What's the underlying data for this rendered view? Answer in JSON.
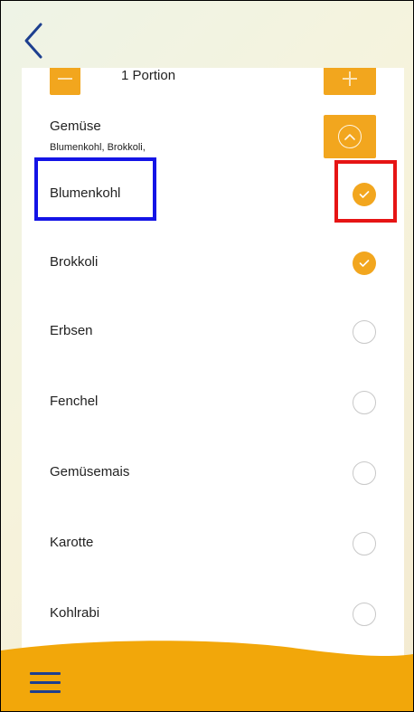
{
  "nav": {
    "back_icon": "chevron-left-icon"
  },
  "portion": {
    "label": "1 Portion",
    "minus_icon": "minus-icon",
    "plus_icon": "plus-icon"
  },
  "category": {
    "title": "Gemüse",
    "selected_summary": "Blumenkohl, Brokkoli,",
    "collapse_icon": "chevron-up-circle-icon"
  },
  "items": [
    {
      "label": "Blumenkohl",
      "checked": true
    },
    {
      "label": "Brokkoli",
      "checked": true
    },
    {
      "label": "Erbsen",
      "checked": false
    },
    {
      "label": "Fenchel",
      "checked": false
    },
    {
      "label": "Gemüsemais",
      "checked": false
    },
    {
      "label": "Karotte",
      "checked": false
    },
    {
      "label": "Kohlrabi",
      "checked": false
    }
  ],
  "footer": {
    "menu_icon": "hamburger-menu-icon"
  },
  "colors": {
    "accent": "#f2a61e",
    "nav_icon": "#1d3f8f",
    "highlight_label": "#1414e6",
    "highlight_check": "#e61414"
  }
}
